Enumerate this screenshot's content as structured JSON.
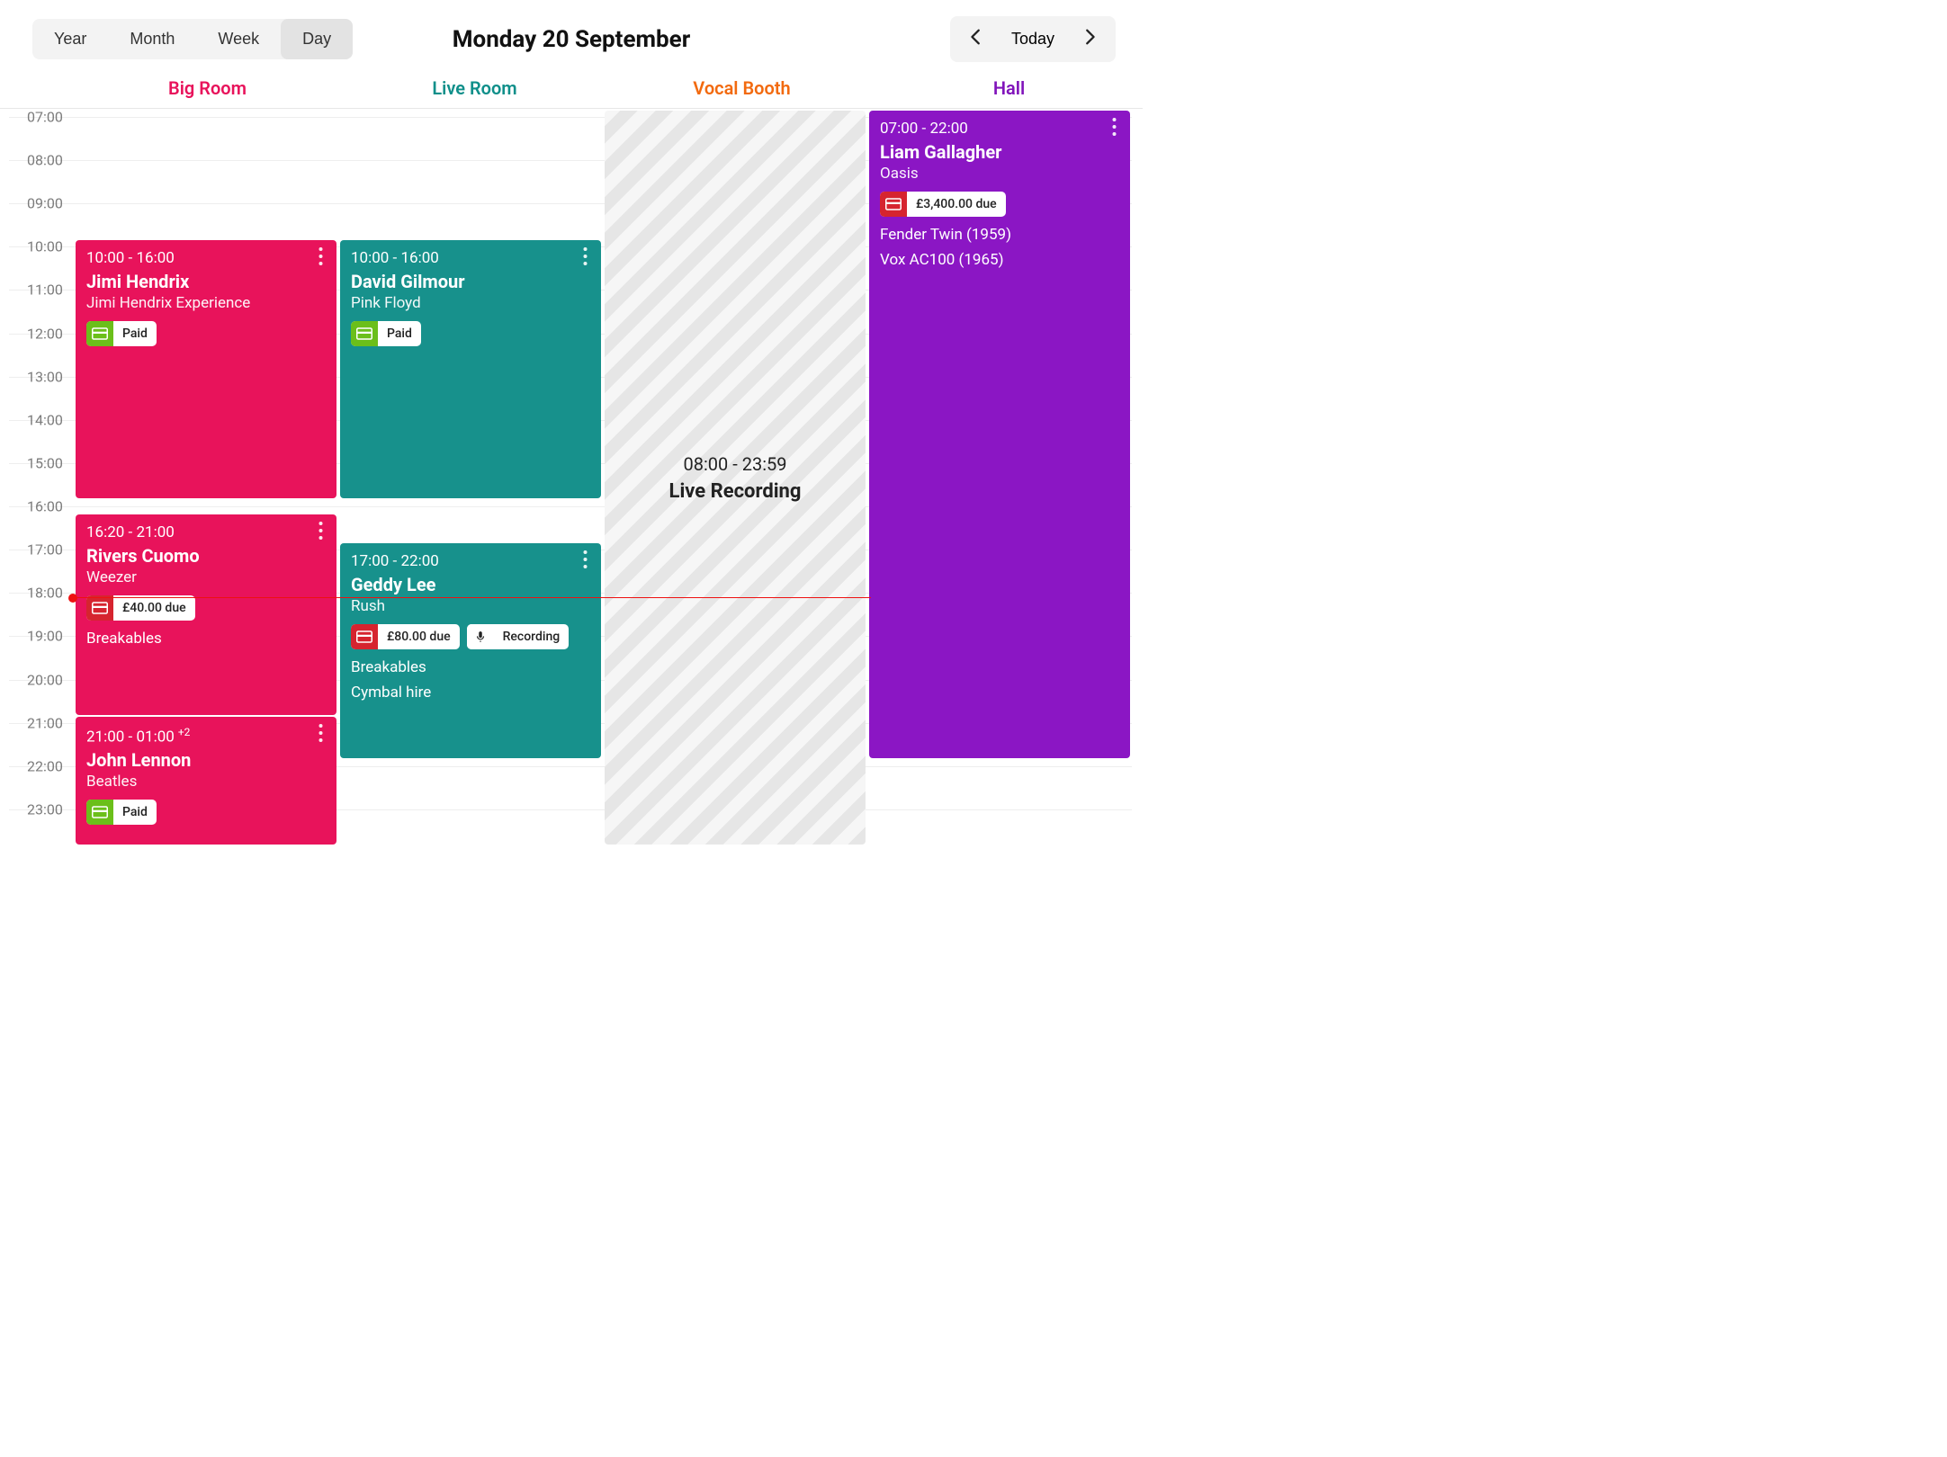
{
  "header": {
    "title": "Monday 20 September",
    "today_label": "Today",
    "view_tabs": [
      "Year",
      "Month",
      "Week",
      "Day"
    ],
    "active_view": "Day"
  },
  "columns": [
    {
      "id": "big",
      "label": "Big Room",
      "color": "#e8135b"
    },
    {
      "id": "live",
      "label": "Live Room",
      "color": "#0f8f8a"
    },
    {
      "id": "vocal",
      "label": "Vocal Booth",
      "color": "#f26a0f"
    },
    {
      "id": "hall",
      "label": "Hall",
      "color": "#8013ba"
    }
  ],
  "hours_start": 7,
  "hours_end": 24,
  "now_hour": 18.1,
  "events": {
    "big": [
      {
        "time": "10:00 - 16:00",
        "who": "Jimi Hendrix",
        "band": "Jimi Hendrix Experience",
        "start": 10,
        "end": 16,
        "badges": [
          {
            "kind": "paid",
            "text": "Paid"
          }
        ]
      },
      {
        "time": "16:20 - 21:00",
        "who": "Rivers Cuomo",
        "band": "Weezer",
        "start": 16.33,
        "end": 21,
        "badges": [
          {
            "kind": "due",
            "text": "£40.00 due"
          }
        ],
        "extras": [
          "Breakables"
        ]
      },
      {
        "time": "21:00 - 01:00",
        "sup": "+2",
        "who": "John Lennon",
        "band": "Beatles",
        "start": 21,
        "end": 25,
        "badges": [
          {
            "kind": "paid",
            "text": "Paid"
          }
        ]
      }
    ],
    "live": [
      {
        "time": "10:00 - 16:00",
        "who": "David Gilmour",
        "band": "Pink Floyd",
        "start": 10,
        "end": 16,
        "badges": [
          {
            "kind": "paid",
            "text": "Paid"
          }
        ]
      },
      {
        "time": "17:00 - 22:00",
        "who": "Geddy Lee",
        "band": "Rush",
        "start": 17,
        "end": 22,
        "badges": [
          {
            "kind": "due",
            "text": "£80.00 due"
          },
          {
            "kind": "tag",
            "icon": "mic",
            "text": "Recording"
          }
        ],
        "extras": [
          "Breakables",
          "Cymbal hire"
        ]
      }
    ],
    "vocal_block": {
      "time": "08:00 - 23:59",
      "label": "Live Recording",
      "start": 7,
      "end": 24
    },
    "hall": [
      {
        "time": "07:00 - 22:00",
        "who": "Liam Gallagher",
        "band": "Oasis",
        "start": 7,
        "end": 22,
        "badges": [
          {
            "kind": "due",
            "text": "£3,400.00 due"
          }
        ],
        "extras": [
          "Fender Twin (1959)",
          "Vox AC100 (1965)"
        ]
      }
    ]
  }
}
